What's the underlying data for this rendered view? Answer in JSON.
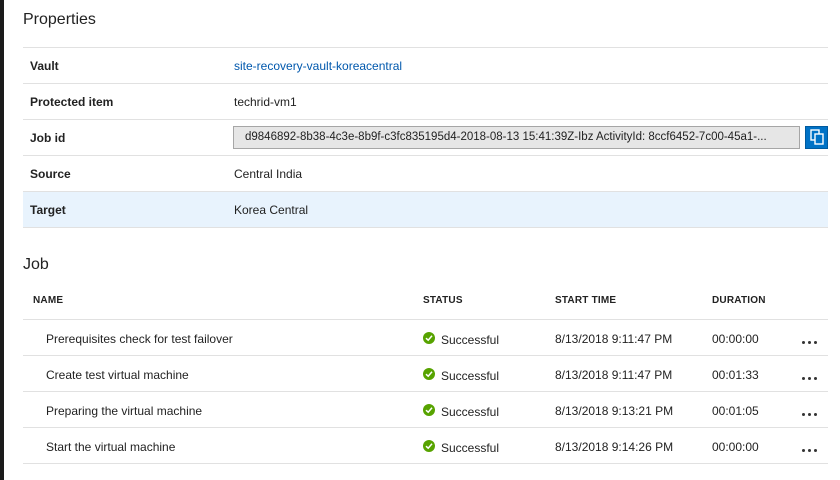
{
  "properties": {
    "title": "Properties",
    "rows": [
      {
        "label": "Vault",
        "value": "site-recovery-vault-koreacentral"
      },
      {
        "label": "Protected item",
        "value": "techrid-vm1"
      },
      {
        "label": "Job id",
        "value": "d9846892-8b38-4c3e-8b9f-c3fc835195d4-2018-08-13 15:41:39Z-Ibz ActivityId: 8ccf6452-7c00-45a1-..."
      },
      {
        "label": "Source",
        "value": "Central India"
      },
      {
        "label": "Target",
        "value": "Korea Central"
      }
    ]
  },
  "job": {
    "title": "Job",
    "headers": {
      "name": "NAME",
      "status": "STATUS",
      "start_time": "START TIME",
      "duration": "DURATION"
    },
    "rows": [
      {
        "name": "Prerequisites check for test failover",
        "status": "Successful",
        "start_time": "8/13/2018 9:11:47 PM",
        "duration": "00:00:00",
        "more": "..."
      },
      {
        "name": "Create test virtual machine",
        "status": "Successful",
        "start_time": "8/13/2018 9:11:47 PM",
        "duration": "00:01:33",
        "more": "..."
      },
      {
        "name": "Preparing the virtual machine",
        "status": "Successful",
        "start_time": "8/13/2018 9:13:21 PM",
        "duration": "00:01:05",
        "more": "..."
      },
      {
        "name": "Start the virtual machine",
        "status": "Successful",
        "start_time": "8/13/2018 9:14:26 PM",
        "duration": "00:00:00",
        "more": "..."
      }
    ]
  },
  "colors": {
    "link": "#0058ad",
    "success": "#57a300",
    "accent": "#0072c6",
    "selected_row": "#e8f3fd"
  },
  "icons": {
    "copy": "copy-icon",
    "status": "check-circle-icon",
    "more": "ellipsis-icon"
  }
}
